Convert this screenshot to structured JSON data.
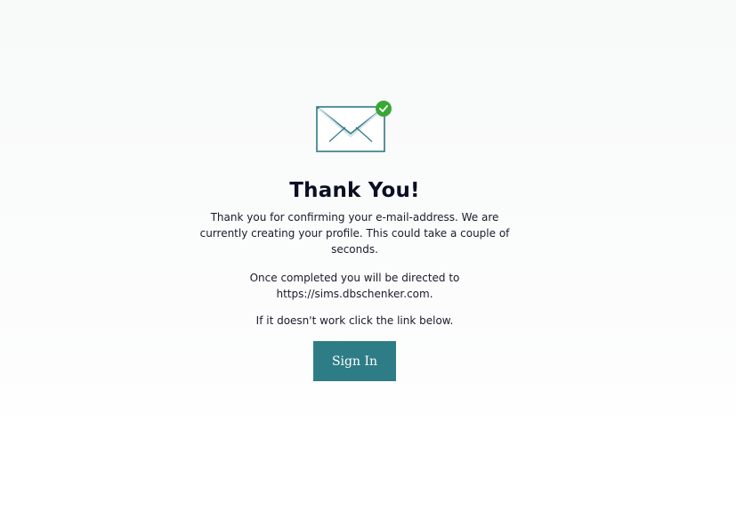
{
  "page": {
    "title": "Thank You!",
    "message_line_1": "Thank you for confirming your e-mail-address. We are currently creating your profile. This could take a couple of seconds.",
    "redirect_text": "Once completed you will be directed to https://sims.dbschenker.com.",
    "fallback_text": "If it doesn't work click the link below.",
    "sign_in_label": "Sign In"
  },
  "icons": {
    "envelope": "envelope-icon",
    "check": "check-badge-icon"
  },
  "colors": {
    "primary": "#2e7d86",
    "check_green": "#3aa636",
    "envelope_stroke": "#2f7a87"
  }
}
